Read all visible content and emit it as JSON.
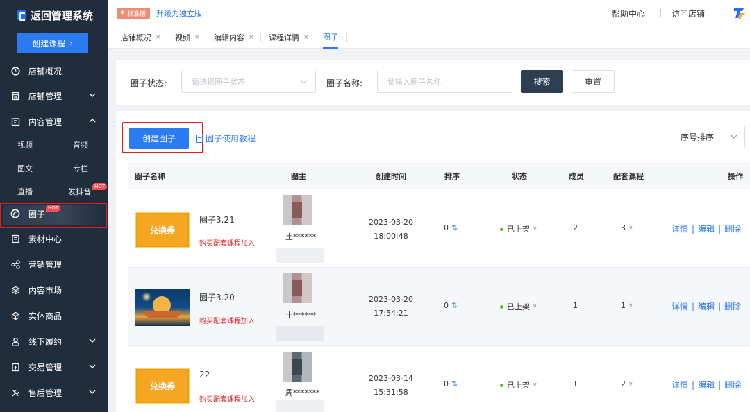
{
  "sidebar": {
    "logo": "返回管理系统",
    "create_course": "创建课程",
    "items": {
      "overview": "店铺概况",
      "shop": "店铺管理",
      "content": "内容管理",
      "video": "视频",
      "audio": "音频",
      "article": "图文",
      "column": "专栏",
      "live": "直播",
      "douyin": "发抖音",
      "circle": "圈子",
      "material": "素材中心",
      "marketing": "营销管理",
      "market": "内容市场",
      "goods": "实体商品",
      "offline": "线下履约",
      "trade": "交易管理",
      "aftersale": "售后管理"
    },
    "hot": "HOT"
  },
  "topbar": {
    "edition": "标准版",
    "upgrade": "升级为独立版",
    "help": "帮助中心",
    "visit": "访问店铺"
  },
  "tabs": [
    "店铺概况",
    "视频",
    "编辑内容",
    "课程详情",
    "圈子"
  ],
  "search": {
    "status_label": "圈子状态:",
    "status_placeholder": "请选择圈子状态",
    "name_label": "圈子名称:",
    "name_placeholder": "请输入圈子名称",
    "search_btn": "搜索",
    "reset_btn": "重置"
  },
  "main": {
    "create_circle": "创建圈子",
    "tutorial": "圈子使用教程",
    "sort": "序号排序"
  },
  "table": {
    "headers": [
      "圈子名称",
      "圈主",
      "创建时间",
      "排序",
      "状态",
      "成员",
      "配套课程",
      "操作"
    ],
    "coupon_text": "兑换券",
    "buy_link": "购买配套课程加入",
    "rows": [
      {
        "name": "圈子3.21",
        "owner": "土******",
        "date": "2023-03-20",
        "time": "18:00:48",
        "order": "0",
        "status": "已上架",
        "members": "2",
        "course": "3"
      },
      {
        "name": "圈子3.20",
        "owner": "土******",
        "date": "2023-03-20",
        "time": "17:54:21",
        "order": "0",
        "status": "已上架",
        "members": "1",
        "course": "1"
      },
      {
        "name": "22",
        "owner": "周*******",
        "date": "2023-03-14",
        "time": "15:31:58",
        "order": "0",
        "status": "已上架",
        "members": "1",
        "course": "2"
      }
    ],
    "actions": {
      "detail": "详情",
      "edit": "编辑",
      "delete": "删除"
    }
  },
  "colors": {
    "sidebar": "#1f2d3d",
    "primary": "#2b7bf3",
    "danger": "#e02020"
  }
}
